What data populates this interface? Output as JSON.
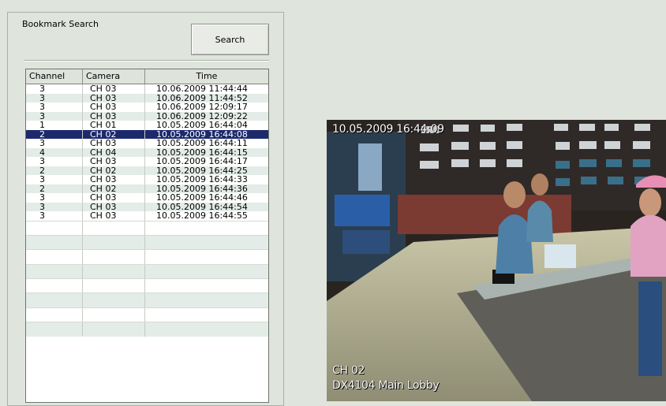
{
  "panel": {
    "title": "Bookmark Search",
    "search_button": "Search"
  },
  "table": {
    "headers": [
      "Channel",
      "Camera",
      "Time"
    ],
    "rows": [
      {
        "channel": "3",
        "camera": "CH 03",
        "time": "10.06.2009  11:44:44"
      },
      {
        "channel": "3",
        "camera": "CH 03",
        "time": "10.06.2009  11:44:52"
      },
      {
        "channel": "3",
        "camera": "CH 03",
        "time": "10.06.2009  12:09:17"
      },
      {
        "channel": "3",
        "camera": "CH 03",
        "time": "10.06.2009  12:09:22"
      },
      {
        "channel": "1",
        "camera": "CH 01",
        "time": "10.05.2009  16:44:04"
      },
      {
        "channel": "2",
        "camera": "CH 02",
        "time": "10.05.2009  16:44:08"
      },
      {
        "channel": "3",
        "camera": "CH 03",
        "time": "10.05.2009  16:44:11"
      },
      {
        "channel": "4",
        "camera": "CH 04",
        "time": "10.05.2009  16:44:15"
      },
      {
        "channel": "3",
        "camera": "CH 03",
        "time": "10.05.2009  16:44:17"
      },
      {
        "channel": "2",
        "camera": "CH 02",
        "time": "10.05.2009  16:44:25"
      },
      {
        "channel": "3",
        "camera": "CH 03",
        "time": "10.05.2009  16:44:33"
      },
      {
        "channel": "2",
        "camera": "CH 02",
        "time": "10.05.2009  16:44:36"
      },
      {
        "channel": "3",
        "camera": "CH 03",
        "time": "10.05.2009  16:44:46"
      },
      {
        "channel": "3",
        "camera": "CH 03",
        "time": "10.05.2009  16:44:54"
      },
      {
        "channel": "3",
        "camera": "CH 03",
        "time": "10.05.2009  16:44:55"
      }
    ],
    "selected_index": 5,
    "empty_rows": 8
  },
  "video": {
    "timestamp": "10.05.2009 16:44:09",
    "channel": "CH 02",
    "camera_name": "DX4104 Main Lobby"
  },
  "colors": {
    "window_bg": "#dfe5dc",
    "selection": "#1c2a6c",
    "alt_row": "#e3ece6"
  }
}
